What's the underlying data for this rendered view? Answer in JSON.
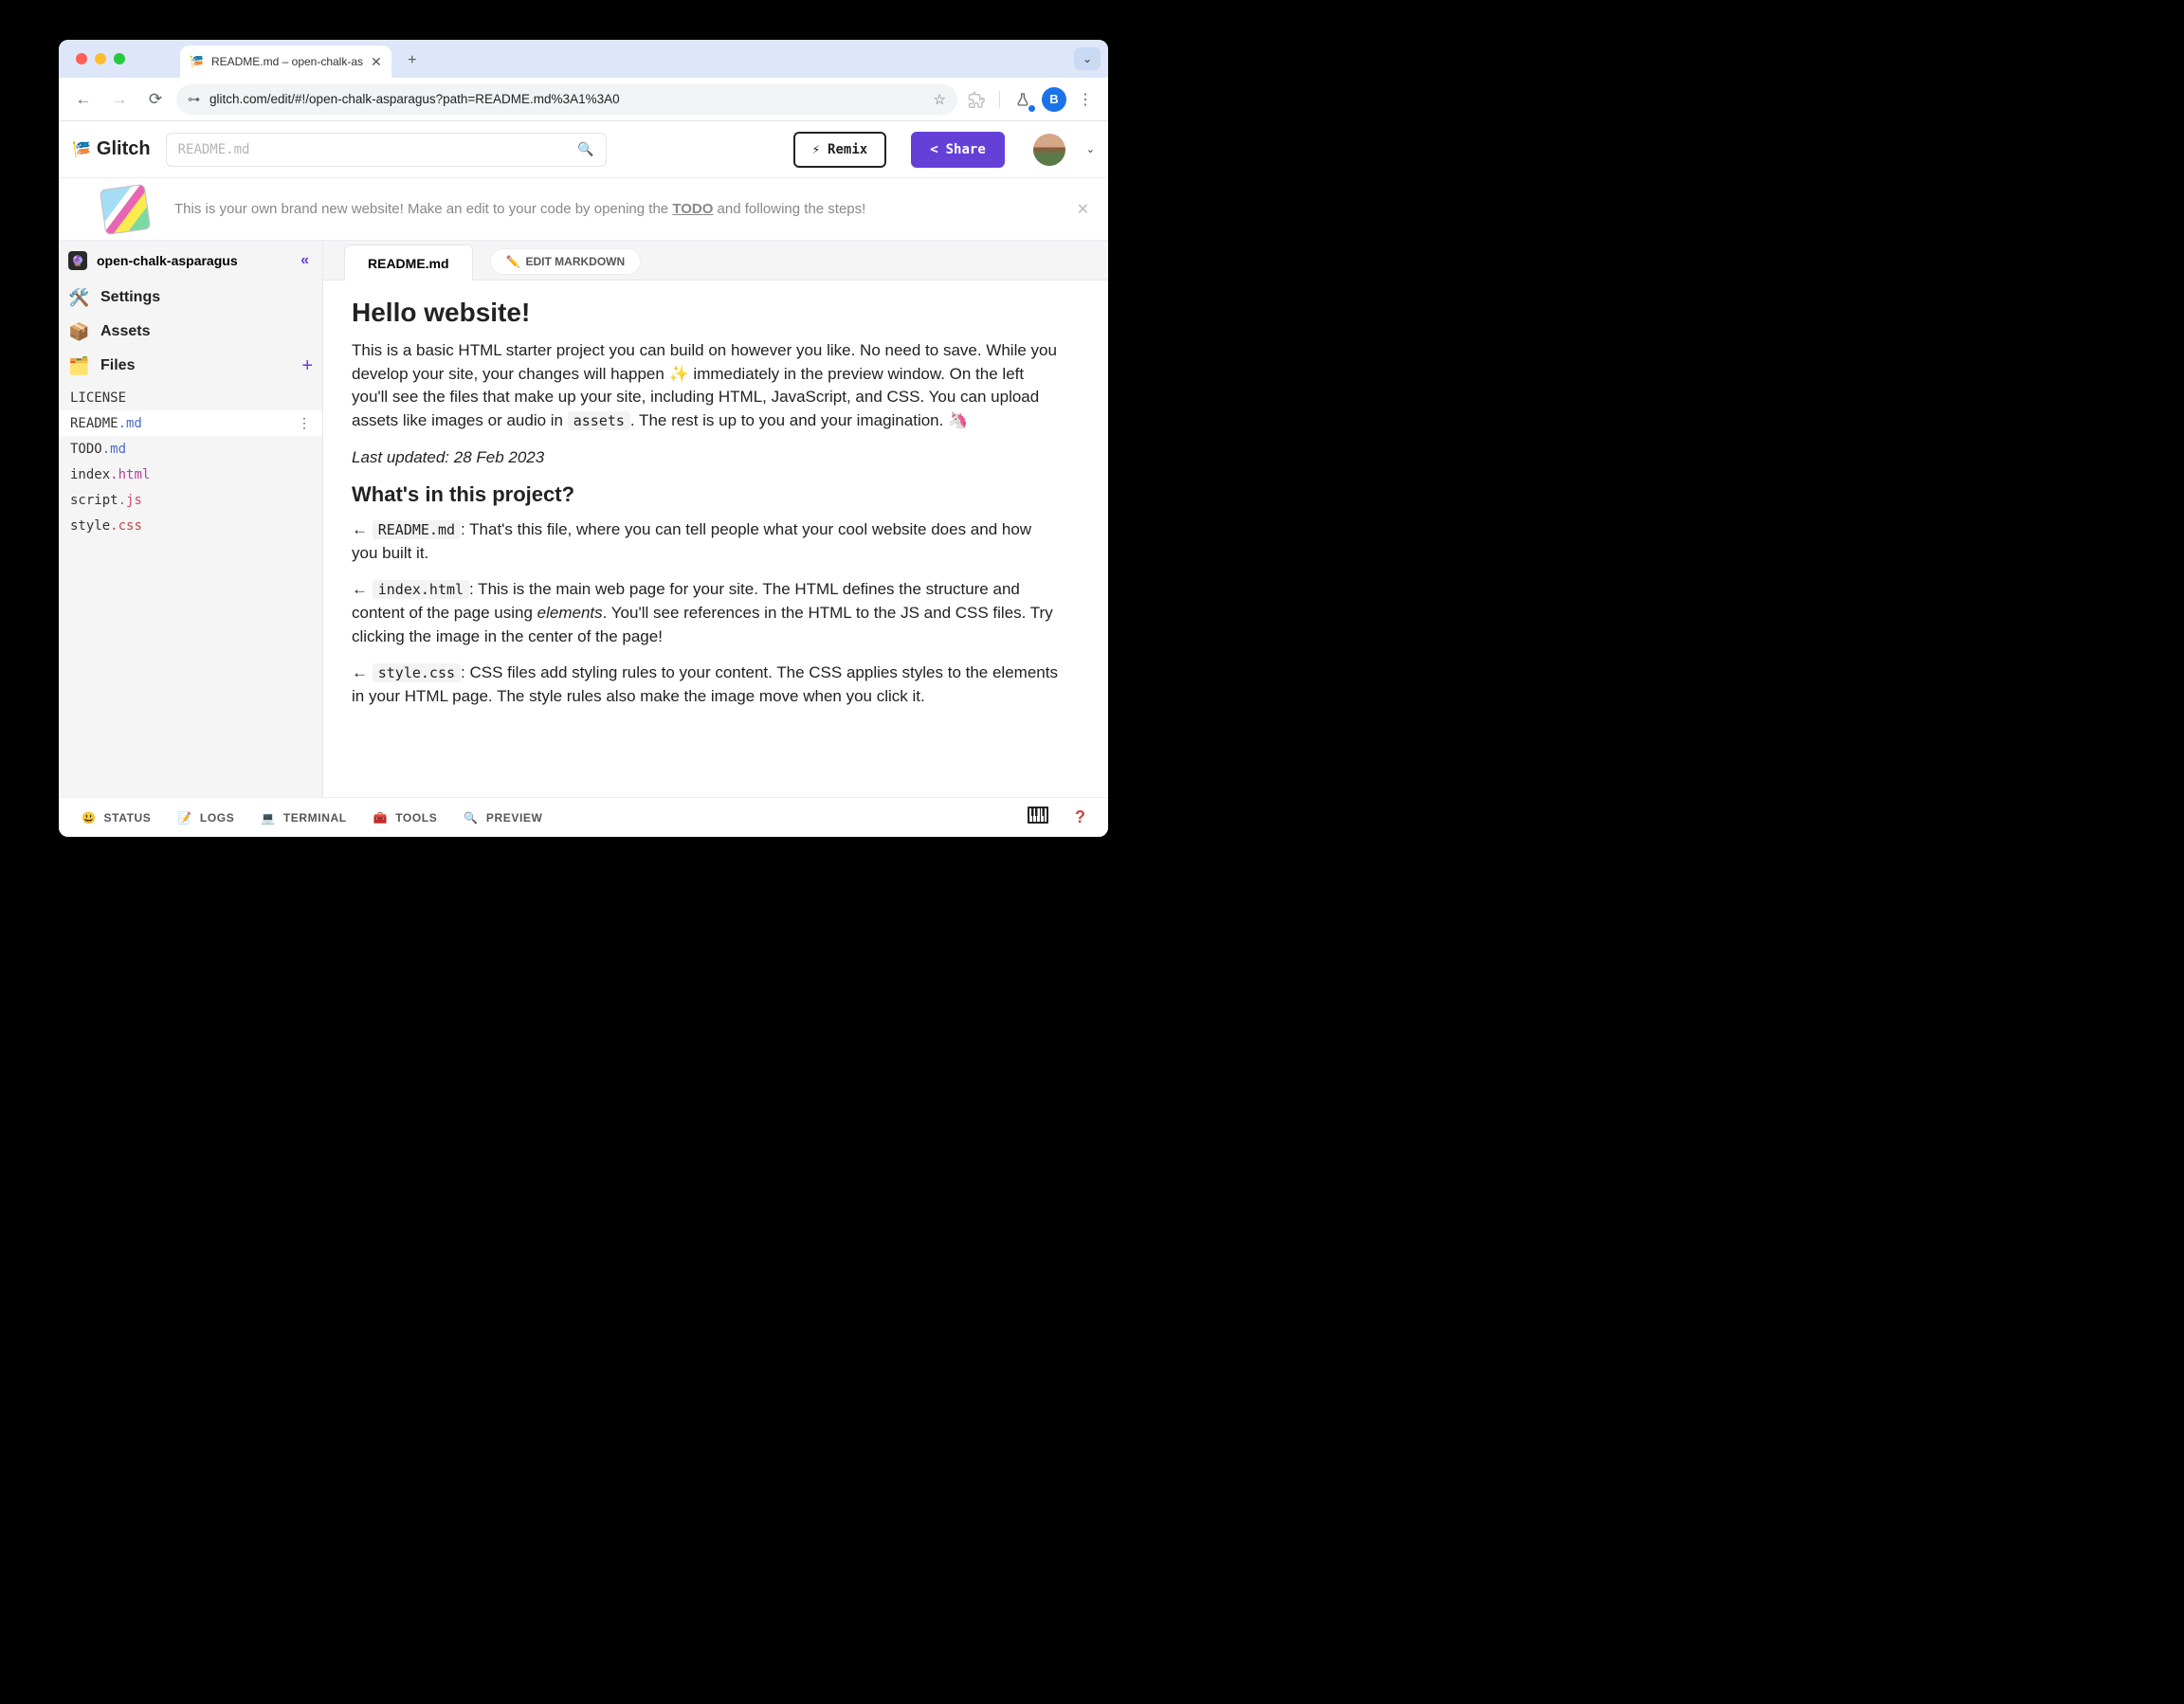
{
  "browser": {
    "tab_title": "README.md – open-chalk-as",
    "url": "glitch.com/edit/#!/open-chalk-asparagus?path=README.md%3A1%3A0",
    "profile_initial": "B"
  },
  "header": {
    "brand": "Glitch",
    "search_placeholder": "README.md",
    "remix_label": "Remix",
    "share_label": "Share"
  },
  "banner": {
    "text_prefix": "This is your own brand new website! Make an edit to your code by opening the ",
    "todo_link": "TODO",
    "text_suffix": " and following the steps!"
  },
  "sidebar": {
    "project_name": "open-chalk-asparagus",
    "settings_label": "Settings",
    "assets_label": "Assets",
    "files_label": "Files",
    "files": [
      {
        "name": "LICENSE",
        "base": "LICENSE",
        "ext": "",
        "active": false
      },
      {
        "name": "README.md",
        "base": "README",
        "ext": ".md",
        "ext_class": "ext-md",
        "active": true
      },
      {
        "name": "TODO.md",
        "base": "TODO",
        "ext": ".md",
        "ext_class": "ext-md",
        "active": false
      },
      {
        "name": "index.html",
        "base": "index",
        "ext": ".html",
        "ext_class": "ext-html",
        "active": false
      },
      {
        "name": "script.js",
        "base": "script",
        "ext": ".js",
        "ext_class": "ext-js",
        "active": false
      },
      {
        "name": "style.css",
        "base": "style",
        "ext": ".css",
        "ext_class": "ext-css",
        "active": false
      }
    ]
  },
  "editor": {
    "tab_label": "README.md",
    "edit_markdown_label": "EDIT MARKDOWN"
  },
  "readme": {
    "h1": "Hello website!",
    "p1_prefix": "This is a basic HTML starter project you can build on however you like. No need to save. While you develop your site, your changes will happen ✨ immediately in the preview window. On the left you'll see the files that make up your site, including HTML, JavaScript, and CSS. You can upload assets like images or audio in ",
    "p1_code": "assets",
    "p1_suffix": ". The rest is up to you and your imagination. 🦄",
    "last_updated": "Last updated: 28 Feb 2023",
    "h2": "What's in this project?",
    "items": [
      {
        "code": "README.md",
        "text": ": That's this file, where you can tell people what your cool website does and how you built it."
      },
      {
        "code": "index.html",
        "text_prefix": ": This is the main web page for your site. The HTML defines the structure and content of the page using ",
        "em": "elements",
        "text_suffix": ". You'll see references in the HTML to the JS and CSS files. Try clicking the image in the center of the page!"
      },
      {
        "code": "style.css",
        "text": ": CSS files add styling rules to your content. The CSS applies styles to the elements in your HTML page. The style rules also make the image move when you click it."
      }
    ]
  },
  "footer": {
    "status": "STATUS",
    "logs": "LOGS",
    "terminal": "TERMINAL",
    "tools": "TOOLS",
    "preview": "PREVIEW"
  }
}
